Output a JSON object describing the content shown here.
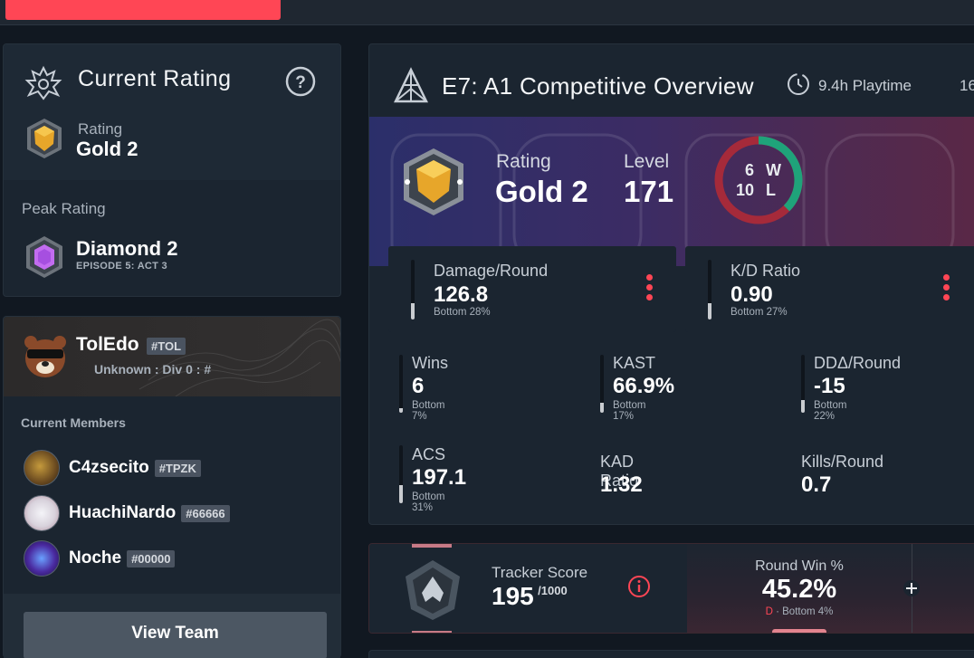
{
  "left": {
    "current_rating": {
      "title": "Current Rating",
      "rating_label": "Rating",
      "rating_value": "Gold 2"
    },
    "peak_rating": {
      "label": "Peak Rating",
      "value": "Diamond 2",
      "episode": "EPISODE 5: ACT 3"
    },
    "team": {
      "name": "TolEdo",
      "tag": "#TOL",
      "division": "Unknown : Div 0 : #",
      "members_label": "Current Members",
      "members": [
        {
          "name": "C4zsecito",
          "tag": "#TPZK"
        },
        {
          "name": "HuachiNardo",
          "tag": "#66666"
        },
        {
          "name": "Noche",
          "tag": "#00000"
        }
      ],
      "view_team_label": "View Team"
    }
  },
  "overview": {
    "title": "E7: A1 Competitive Overview",
    "playtime": "9.4h Playtime",
    "extra": "16",
    "rating_label": "Rating",
    "rating_value": "Gold 2",
    "level_label": "Level",
    "level_value": "171",
    "wins": "6",
    "wins_letter": "W",
    "losses": "10",
    "losses_letter": "L",
    "win_fraction": 0.375,
    "stats": {
      "damage": {
        "label": "Damage/Round",
        "value": "126.8",
        "pct": "Bottom 28%",
        "level": 0.28
      },
      "kd": {
        "label": "K/D Ratio",
        "value": "0.90",
        "pct": "Bottom 27%",
        "level": 0.27
      },
      "wins": {
        "label": "Wins",
        "value": "6",
        "pct": "Bottom 7%",
        "level": 0.07
      },
      "kast": {
        "label": "KAST",
        "value": "66.9%",
        "pct": "Bottom 17%",
        "level": 0.17
      },
      "dda": {
        "label": "DDΔ/Round",
        "value": "-15",
        "pct": "Bottom 22%",
        "level": 0.22
      },
      "acs": {
        "label": "ACS",
        "value": "197.1",
        "pct": "Bottom 31%",
        "level": 0.31
      },
      "kad": {
        "label": "KAD Ratio",
        "value": "1.32"
      },
      "kills": {
        "label": "Kills/Round",
        "value": "0.7"
      }
    }
  },
  "tracker": {
    "label": "Tracker Score",
    "score": "195",
    "max": "/1000",
    "round_win_label": "Round Win %",
    "round_win_value": "45.2%",
    "grade": "D",
    "grade_pct": "· Bottom 4%"
  },
  "colors": {
    "accent_red": "#ff4655",
    "win_green": "#1fa37a",
    "loss_red": "#a52a3a",
    "gold": "#e7a62a"
  }
}
